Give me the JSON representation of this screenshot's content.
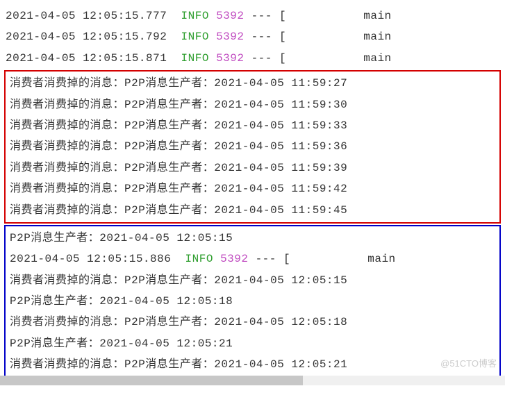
{
  "top_log_lines": [
    {
      "ts": "2021-04-05 12:05:15.777",
      "level": "INFO",
      "pid": "5392",
      "dashes": "---",
      "bracket": "[",
      "thread": "main"
    },
    {
      "ts": "2021-04-05 12:05:15.792",
      "level": "INFO",
      "pid": "5392",
      "dashes": "---",
      "bracket": "[",
      "thread": "main"
    },
    {
      "ts": "2021-04-05 12:05:15.871",
      "level": "INFO",
      "pid": "5392",
      "dashes": "---",
      "bracket": "[",
      "thread": "main"
    }
  ],
  "red_box_lines": [
    "消费者消费掉的消息：P2P消息生产者：2021-04-05 11:59:27",
    "消费者消费掉的消息：P2P消息生产者：2021-04-05 11:59:30",
    "消费者消费掉的消息：P2P消息生产者：2021-04-05 11:59:33",
    "消费者消费掉的消息：P2P消息生产者：2021-04-05 11:59:36",
    "消费者消费掉的消息：P2P消息生产者：2021-04-05 11:59:39",
    "消费者消费掉的消息：P2P消息生产者：2021-04-05 11:59:42",
    "消费者消费掉的消息：P2P消息生产者：2021-04-05 11:59:45"
  ],
  "blue_box": {
    "line1": "P2P消息生产者：2021-04-05 12:05:15",
    "log_line": {
      "ts": "2021-04-05 12:05:15.886",
      "level": "INFO",
      "pid": "5392",
      "dashes": "---",
      "bracket": "[",
      "thread": "main"
    },
    "lines_after": [
      "消费者消费掉的消息：P2P消息生产者：2021-04-05 12:05:15",
      "P2P消息生产者：2021-04-05 12:05:18",
      "消费者消费掉的消息：P2P消息生产者：2021-04-05 12:05:18",
      "P2P消息生产者：2021-04-05 12:05:21",
      "消费者消费掉的消息：P2P消息生产者：2021-04-05 12:05:21"
    ]
  },
  "watermark": "@51CTO博客"
}
